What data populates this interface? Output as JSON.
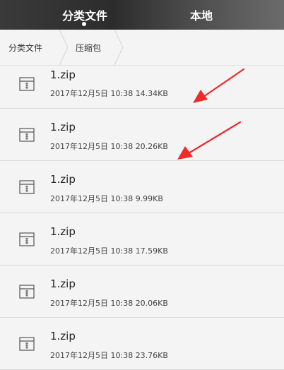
{
  "tabs": {
    "category": "分类文件",
    "local": "本地"
  },
  "breadcrumb": {
    "root": "分类文件",
    "current": "压缩包"
  },
  "files": [
    {
      "name": "1.zip",
      "date": "2017年12月5日 10:38",
      "size": "14.34KB"
    },
    {
      "name": "1.zip",
      "date": "2017年12月5日 10:38",
      "size": "20.26KB"
    },
    {
      "name": "1.zip",
      "date": "2017年12月5日 10:38",
      "size": "9.99KB"
    },
    {
      "name": "1.zip",
      "date": "2017年12月5日 10:38",
      "size": "17.59KB"
    },
    {
      "name": "1.zip",
      "date": "2017年12月5日 10:38",
      "size": "20.06KB"
    },
    {
      "name": "1.zip",
      "date": "2017年12月5日 10:38",
      "size": "23.76KB"
    }
  ],
  "colors": {
    "arrow": "#ee2a2a",
    "topbar": "#2c2c2c"
  }
}
